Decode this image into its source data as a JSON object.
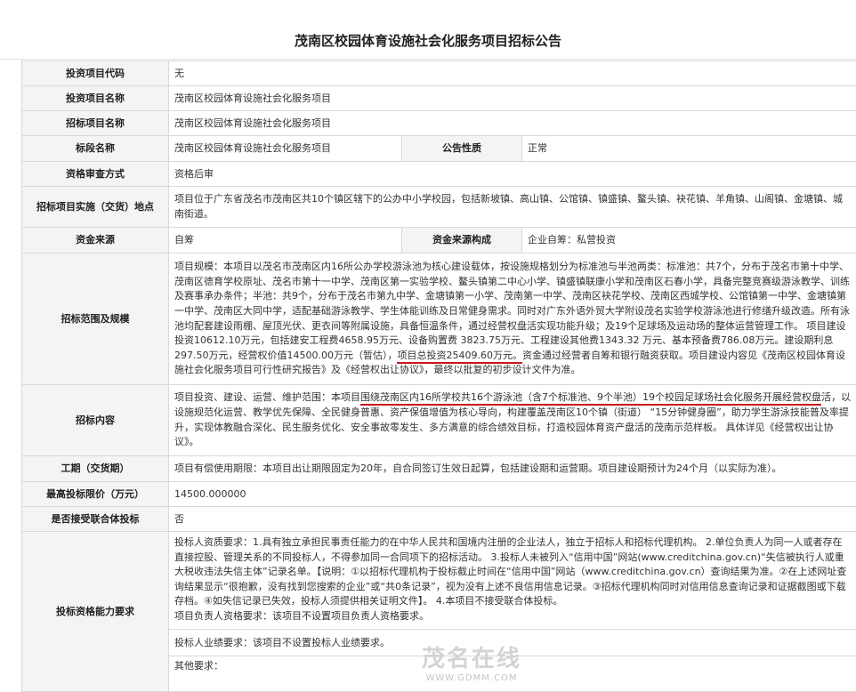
{
  "title": "茂南区校园体育设施社会化服务项目招标公告",
  "rows": {
    "invest_code": {
      "label": "投资项目代码",
      "value": "无"
    },
    "invest_name": {
      "label": "投资项目名称",
      "value": "茂南区校园体育设施社会化服务项目"
    },
    "bid_name": {
      "label": "招标项目名称",
      "value": "茂南区校园体育设施社会化服务项目"
    },
    "section_name": {
      "label": "标段名称",
      "value": "茂南区校园体育设施社会化服务项目",
      "label2": "公告性质",
      "value2": "正常"
    },
    "review": {
      "label": "资格审查方式",
      "value": "资格后审"
    },
    "location": {
      "label": "招标项目实施（交货）地点",
      "value": "项目位于广东省茂名市茂南区共10个镇区辖下的公办中小学校园，包括新坡镇、高山镇、公馆镇、镇盛镇、鳌头镇、袂花镇、羊角镇、山阁镇、金塘镇、城南街道。"
    },
    "funding": {
      "label": "资金来源",
      "value": "自筹",
      "label2": "资金来源构成",
      "value2": "企业自筹：私营投资"
    },
    "scope": {
      "label": "招标范围及规模",
      "text1": "项目规模：本项目以茂名市茂南区内16所公办学校游泳池为核心建设载体，按设施规格划分为标准池与半池两类：标准池：共7个，分布于茂名市第十中学、茂南区德育学校原址、茂名市第十一中学、茂南区第一实验学校、鳌头镇第二中心小学、镇盛镇联康小学和茂南区石春小学，具备完整竞赛级游泳教学、训练及赛事承办条件；半池：共9个，分布于茂名市第九中学、金塘镇第一小学、茂南第一中学、茂南区袂花学校、茂南区西城学校、公馆镇第一中学、金塘镇第一中学、茂南区大同中学，适配基础游泳教学、学生体能训练及日常健身需求。同时对广东外语外贸大学附设茂名实验学校游泳池进行修缮升级改造。所有泳池均配套建设雨棚、屋顶光伏、更衣间等附属设施，具备恒温条件，通过经营权盘活实现功能升级；及19个足球场及运动场的整体运营管理工作。 项目建设投资10612.10万元，包括建安工程费4658.95万元、设备购置费 3823.75万元、工程建设其他费1343.32 万元、基本预备费786.08万元。建设期利息297.50万元，经营权价值14500.00万元（暂估），",
      "highlight": "项目总投资25409.60万元。",
      "text2": "资金通过经营者自筹和银行融资获取。项目建设内容见《茂南区校园体育设施社会化服务项目可行性研究报告》及《经营权出让协议》，最终以批复的初步设计文件为准。"
    },
    "content": {
      "label": "招标内容",
      "text1": "项目投资、建设、运营、维护范围：本项目",
      "highlight": "围绕茂南区内16所学校共16个游泳池（含7个标准池、9个半池）19个校园足球场社会化服务开展经营权盘",
      "text2": "活，以设施规范化运营、教学优先保障、全民健身普惠、资产保值增值为核心导向，构建覆盖茂南区10个镇（街道） “15分钟健身圈”，助力学生游泳技能普及率提升，实现体教融合深化、民生服务优化、安全事故零发生、多方满意的综合绩效目标，打造校园体育资产盘活的茂南示范样板。 具体详见《经营权出让协议》。"
    },
    "period": {
      "label": "工期（交货期）",
      "value": "项目有偿使用期限：本项目出让期限固定为20年，自合同签订生效日起算，包括建设期和运营期。项目建设期预计为24个月（以实际为准）。"
    },
    "max_price": {
      "label": "最高投标限价（万元）",
      "value": "14500.000000"
    },
    "consortium": {
      "label": "是否接受联合体投标",
      "value": "否"
    },
    "qualification": {
      "label": "投标资格能力要求",
      "text": "投标人资质要求：1.具有独立承担民事责任能力的在中华人民共和国境内注册的企业法人，独立于招标人和招标代理机构。 2.单位负责人为同一人或者存在直接控股、管理关系的不同投标人，不得参加同一合同项下的招标活动。 3.投标人未被列入“信用中国”网站(www.creditchina.gov.cn)“失信被执行人或重大税收违法失信主体”记录名单。【说明：①以招标代理机构于投标截止时间在“信用中国”网站（www.creditchina.gov.cn）查询结果为准。②在上述网址查询结果显示“很抱歉，没有找到您搜索的企业”或“共0条记录”，视为没有上述不良信用信息记录。③招标代理机构同时对信用信息查询记录和证据截图或下载存档。④如失信记录已失效，投标人须提供相关证明文件】。 4.本项目不接受联合体投标。",
      "leader": "项目负责人资格要求：该项目不设置项目负责人资格要求。",
      "performance": "投标人业绩要求：该项目不设置投标人业绩要求。",
      "other": "其他要求："
    }
  },
  "watermark": {
    "mark": "茂名在线",
    "url": "WWW.GDMM.COM"
  },
  "colors": {
    "accent_red": "#c8161d",
    "label_bg": "#f4f4f4",
    "border": "#d8d8d8"
  }
}
